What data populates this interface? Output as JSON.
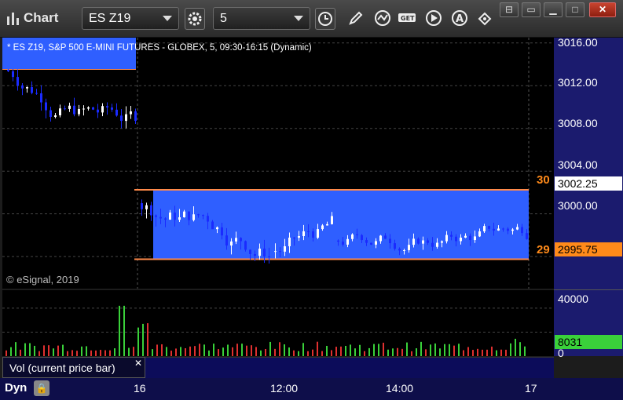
{
  "toolbar": {
    "app_title": "Chart",
    "symbol": "ES Z19",
    "interval": "5"
  },
  "chart": {
    "description": "* ES Z19, S&P 500 E-MINI FUTURES - GLOBEX, 5, 09:30-16:15 (Dynamic)",
    "copyright": "© eSignal, 2019",
    "price_axis_labels": [
      "3016.00",
      "3012.00",
      "3008.00",
      "3004.00",
      "3000.00"
    ],
    "current_price_tag": "3002.25",
    "orange_price_tag": "2995.75",
    "left_tag_upper": "30",
    "left_tag_lower": "29",
    "volume_axis_labels": [
      "40000",
      "0"
    ],
    "volume_tag": "8031",
    "volume_legend": "Vol (current price bar)",
    "time_labels": [
      "16",
      "12:00",
      "14:00",
      "17"
    ],
    "dyn_label": "Dyn",
    "colors": {
      "up_bar": "#ffffff",
      "down_bar": "#1a2bff",
      "range_box": "#2f5fff",
      "level_line": "#ff8a4a",
      "volume_up": "#3ad13a",
      "volume_down": "#e03030",
      "volume_tag": "#3ad13a",
      "price_tag_current": "#ffffff",
      "price_tag_orange": "#ff8a1a",
      "axis_background": "#1b1b6e"
    }
  },
  "chart_data": {
    "type": "candlestick",
    "ylim": [
      2993,
      3016.5
    ],
    "levels": [
      3002.25,
      2995.75
    ],
    "volume_ylim": [
      0,
      55000
    ]
  }
}
